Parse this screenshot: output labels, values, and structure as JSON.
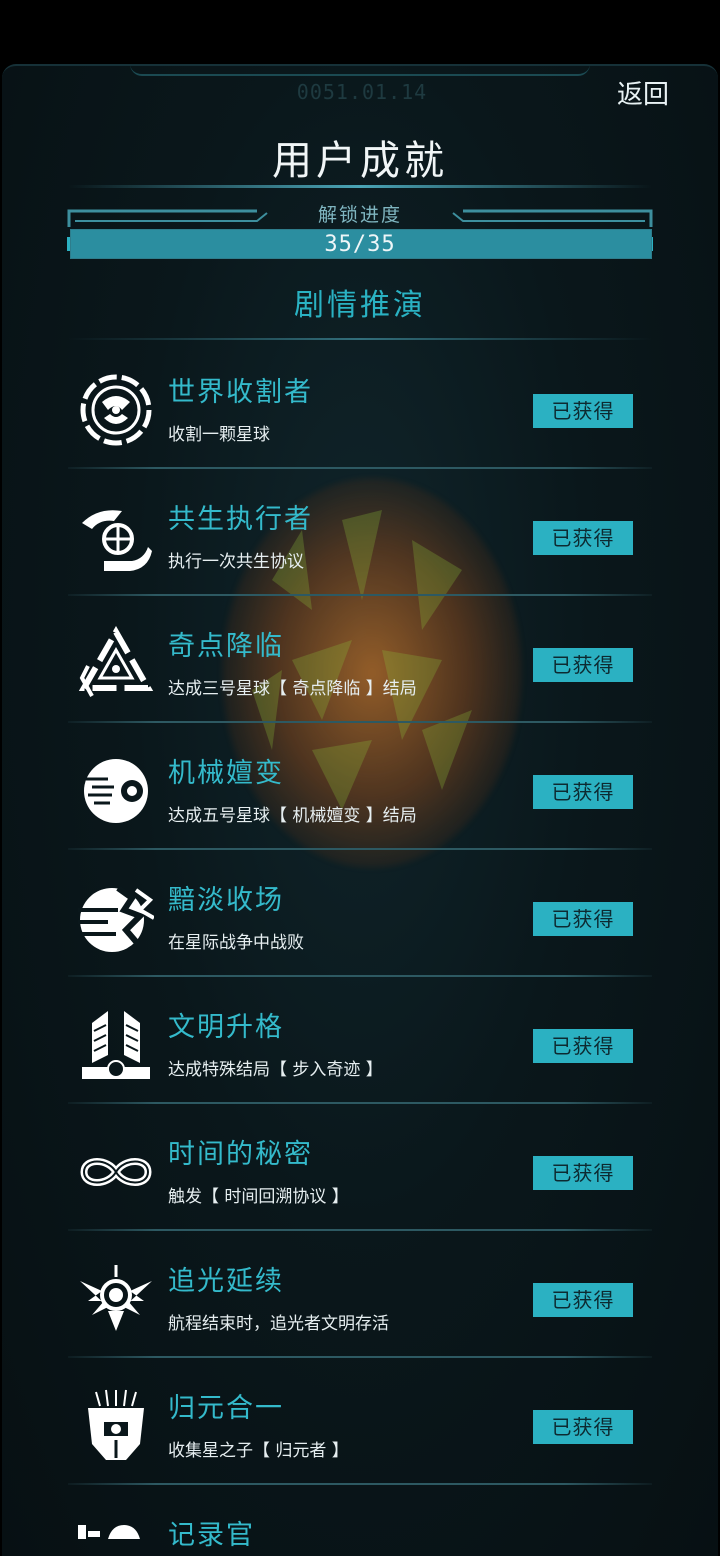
{
  "header": {
    "timestamp": "0051.01.14",
    "back_label": "返回",
    "title": "用户成就"
  },
  "progress": {
    "label": "解锁进度",
    "text": "35/35",
    "fraction": 1.0
  },
  "section": {
    "title": "剧情推演"
  },
  "achievements": [
    {
      "name": "世界收割者",
      "desc": "收割一颗星球",
      "status": "已获得",
      "icon": "harvester-icon"
    },
    {
      "name": "共生执行者",
      "desc": "执行一次共生协议",
      "status": "已获得",
      "icon": "symbiosis-icon"
    },
    {
      "name": "奇点降临",
      "desc": "达成三号星球【 奇点降临 】结局",
      "status": "已获得",
      "icon": "singularity-icon"
    },
    {
      "name": "机械嬗变",
      "desc": "达成五号星球【 机械嬗变 】结局",
      "status": "已获得",
      "icon": "mechanical-eye-icon"
    },
    {
      "name": "黯淡收场",
      "desc": "在星际战争中战败",
      "status": "已获得",
      "icon": "defeat-planet-icon"
    },
    {
      "name": "文明升格",
      "desc": "达成特殊结局【 步入奇迹 】",
      "status": "已获得",
      "icon": "winged-emblem-icon"
    },
    {
      "name": "时间的秘密",
      "desc": "触发【 时间回溯协议 】",
      "status": "已获得",
      "icon": "infinity-icon"
    },
    {
      "name": "追光延续",
      "desc": "航程结束时，追光者文明存活",
      "status": "已获得",
      "icon": "light-chaser-icon"
    },
    {
      "name": "归元合一",
      "desc": "收集星之子【 归元者 】",
      "status": "已获得",
      "icon": "mask-icon"
    },
    {
      "name": "记录官",
      "desc": "",
      "status": "",
      "icon": "recorder-icon"
    }
  ]
}
